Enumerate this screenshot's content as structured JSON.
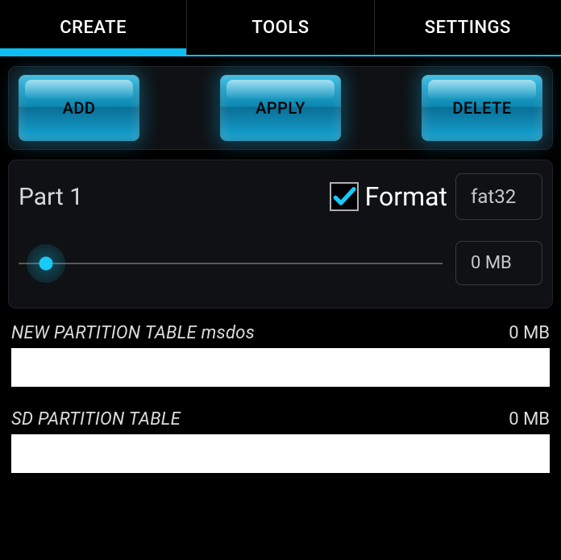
{
  "tabs": {
    "create": "CREATE",
    "tools": "TOOLS",
    "settings": "SETTINGS",
    "active": "create"
  },
  "toolbar": {
    "add": "ADD",
    "apply": "APPLY",
    "delete": "DELETE"
  },
  "partition": {
    "label": "Part 1",
    "format_checked": true,
    "format_label": "Format",
    "filesystem": "fat32",
    "size": "0 MB"
  },
  "tables": [
    {
      "title": "NEW PARTITION TABLE msdos",
      "size": "0 MB"
    },
    {
      "title": "SD PARTITION TABLE",
      "size": "0 MB"
    }
  ],
  "colors": {
    "accent": "#0dbff2",
    "button_glow": "#17a7d6"
  }
}
